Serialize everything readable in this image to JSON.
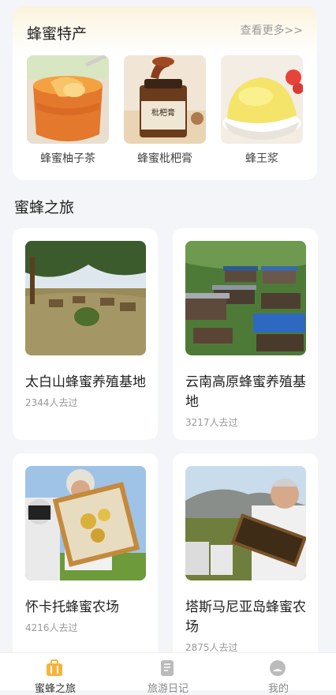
{
  "specialty": {
    "title": "蜂蜜特产",
    "more": "查看更多>>",
    "items": [
      {
        "name": "蜂蜜柚子茶",
        "image": "honey-citron-tea-image"
      },
      {
        "name": "蜂蜜枇杷膏",
        "image": "loquat-syrup-jar-image",
        "jar_label": "枇杷膏"
      },
      {
        "name": "蜂王浆",
        "image": "royal-jelly-bowl-image"
      }
    ]
  },
  "journey": {
    "title": "蜜蜂之旅",
    "places": [
      {
        "name": "太白山蜂蜜养殖基地",
        "count": "2344人去过",
        "image": "apiary-field-image"
      },
      {
        "name": "云南高原蜂蜜养殖基地",
        "count": "3217人去过",
        "image": "plateau-hives-image"
      },
      {
        "name": "怀卡托蜂蜜农场",
        "count": "4216人去过",
        "image": "beekeeper-frame-image"
      },
      {
        "name": "塔斯马尼亚岛蜂蜜农场",
        "count": "2875人去过",
        "image": "tasmania-beekeeper-image"
      }
    ]
  },
  "tabs": [
    {
      "label": "蜜蜂之旅",
      "icon": "suitcase-icon",
      "active": true
    },
    {
      "label": "旅游日记",
      "icon": "notebook-icon",
      "active": false
    },
    {
      "label": "我的",
      "icon": "profile-icon",
      "active": false
    }
  ],
  "colors": {
    "accent": "#f6b43a",
    "inactive": "#bbbbbb"
  }
}
